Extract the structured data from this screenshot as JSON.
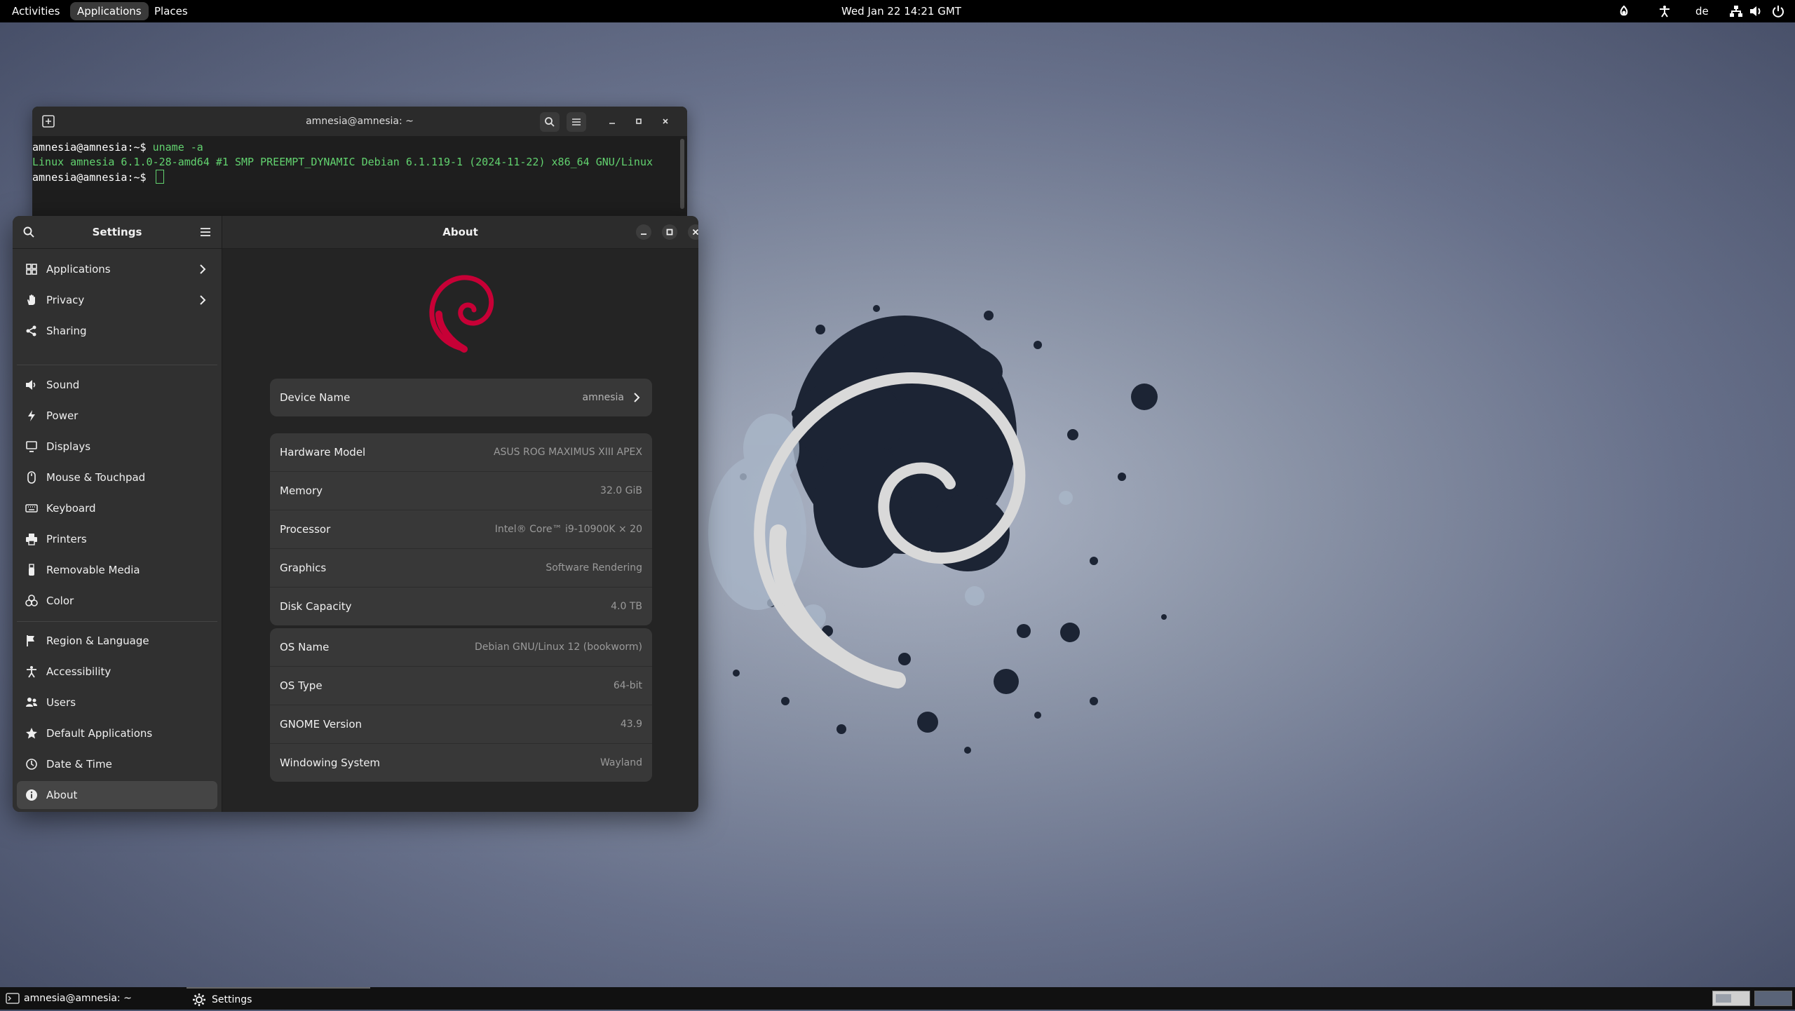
{
  "topbar": {
    "activities": "Activities",
    "applications": "Applications",
    "places": "Places",
    "clock": "Wed Jan 22  14:21 GMT",
    "keyboard_layout": "de"
  },
  "terminal": {
    "title": "amnesia@amnesia: ~",
    "lines": {
      "l1_prompt": "amnesia@amnesia:~$ ",
      "l1_cmd": "uname -a",
      "l2": "Linux amnesia 6.1.0-28-amd64 #1 SMP PREEMPT_DYNAMIC Debian 6.1.119-1 (2024-11-22) x86_64 GNU/Linux",
      "l3_prompt": "amnesia@amnesia:~$ "
    }
  },
  "settings": {
    "sidebar_title": "Settings",
    "page_title": "About",
    "sidebar": [
      {
        "label": "Applications",
        "icon": "grid-icon",
        "has_chevron": true
      },
      {
        "label": "Privacy",
        "icon": "hand-icon",
        "has_chevron": true
      },
      {
        "label": "Sharing",
        "icon": "share-icon"
      },
      {
        "label": "Sound",
        "icon": "speaker-icon"
      },
      {
        "label": "Power",
        "icon": "power-icon"
      },
      {
        "label": "Displays",
        "icon": "display-icon"
      },
      {
        "label": "Mouse & Touchpad",
        "icon": "mouse-icon"
      },
      {
        "label": "Keyboard",
        "icon": "keyboard-icon"
      },
      {
        "label": "Printers",
        "icon": "printer-icon"
      },
      {
        "label": "Removable Media",
        "icon": "usb-icon"
      },
      {
        "label": "Color",
        "icon": "palette-icon"
      },
      {
        "label": "Region & Language",
        "icon": "flag-icon"
      },
      {
        "label": "Accessibility",
        "icon": "accessibility-icon"
      },
      {
        "label": "Users",
        "icon": "users-icon"
      },
      {
        "label": "Default Applications",
        "icon": "star-icon"
      },
      {
        "label": "Date & Time",
        "icon": "clock-icon"
      },
      {
        "label": "About",
        "icon": "info-icon",
        "active": true
      }
    ],
    "device": {
      "label": "Device Name",
      "value": "amnesia"
    },
    "hardware": [
      {
        "label": "Hardware Model",
        "value": "ASUS ROG MAXIMUS XIII APEX"
      },
      {
        "label": "Memory",
        "value": "32.0 GiB"
      },
      {
        "label": "Processor",
        "value": "Intel® Core™ i9-10900K × 20"
      },
      {
        "label": "Graphics",
        "value": "Software Rendering"
      },
      {
        "label": "Disk Capacity",
        "value": "4.0 TB"
      }
    ],
    "os": [
      {
        "label": "OS Name",
        "value": "Debian GNU/Linux 12 (bookworm)"
      },
      {
        "label": "OS Type",
        "value": "64-bit"
      },
      {
        "label": "GNOME Version",
        "value": "43.9"
      },
      {
        "label": "Windowing System",
        "value": "Wayland"
      }
    ]
  },
  "taskbar": {
    "terminal_task": "amnesia@amnesia: ~",
    "settings_task": "Settings"
  },
  "colors": {
    "debian_red": "#c70036",
    "terminal_green": "#62d26f"
  }
}
